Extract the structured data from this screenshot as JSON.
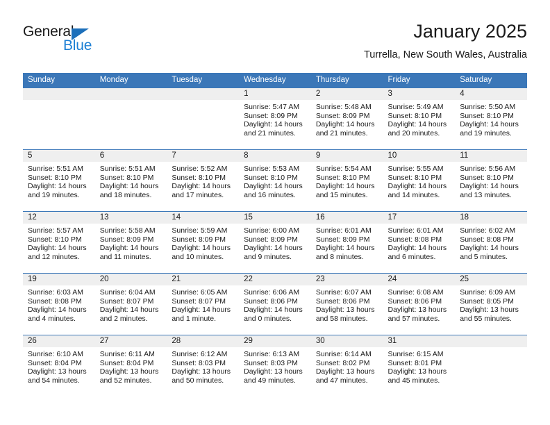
{
  "logo": {
    "word1": "General",
    "word2": "Blue",
    "triangle_color": "#1c6fba",
    "blue_color": "#1c7fd4"
  },
  "header": {
    "title": "January 2025",
    "subtitle": "Turrella, New South Wales, Australia"
  },
  "theme": {
    "header_bg": "#3b77b8",
    "datenum_bg": "#efefef",
    "text": "#1a1a1a"
  },
  "calendar": {
    "weekday_headers": [
      "Sunday",
      "Monday",
      "Tuesday",
      "Wednesday",
      "Thursday",
      "Friday",
      "Saturday"
    ],
    "weeks": [
      [
        {
          "day": "",
          "empty": true
        },
        {
          "day": "",
          "empty": true
        },
        {
          "day": "",
          "empty": true
        },
        {
          "day": "1",
          "sunrise": "Sunrise: 5:47 AM",
          "sunset": "Sunset: 8:09 PM",
          "daylight1": "Daylight: 14 hours",
          "daylight2": "and 21 minutes."
        },
        {
          "day": "2",
          "sunrise": "Sunrise: 5:48 AM",
          "sunset": "Sunset: 8:09 PM",
          "daylight1": "Daylight: 14 hours",
          "daylight2": "and 21 minutes."
        },
        {
          "day": "3",
          "sunrise": "Sunrise: 5:49 AM",
          "sunset": "Sunset: 8:10 PM",
          "daylight1": "Daylight: 14 hours",
          "daylight2": "and 20 minutes."
        },
        {
          "day": "4",
          "sunrise": "Sunrise: 5:50 AM",
          "sunset": "Sunset: 8:10 PM",
          "daylight1": "Daylight: 14 hours",
          "daylight2": "and 19 minutes."
        }
      ],
      [
        {
          "day": "5",
          "sunrise": "Sunrise: 5:51 AM",
          "sunset": "Sunset: 8:10 PM",
          "daylight1": "Daylight: 14 hours",
          "daylight2": "and 19 minutes."
        },
        {
          "day": "6",
          "sunrise": "Sunrise: 5:51 AM",
          "sunset": "Sunset: 8:10 PM",
          "daylight1": "Daylight: 14 hours",
          "daylight2": "and 18 minutes."
        },
        {
          "day": "7",
          "sunrise": "Sunrise: 5:52 AM",
          "sunset": "Sunset: 8:10 PM",
          "daylight1": "Daylight: 14 hours",
          "daylight2": "and 17 minutes."
        },
        {
          "day": "8",
          "sunrise": "Sunrise: 5:53 AM",
          "sunset": "Sunset: 8:10 PM",
          "daylight1": "Daylight: 14 hours",
          "daylight2": "and 16 minutes."
        },
        {
          "day": "9",
          "sunrise": "Sunrise: 5:54 AM",
          "sunset": "Sunset: 8:10 PM",
          "daylight1": "Daylight: 14 hours",
          "daylight2": "and 15 minutes."
        },
        {
          "day": "10",
          "sunrise": "Sunrise: 5:55 AM",
          "sunset": "Sunset: 8:10 PM",
          "daylight1": "Daylight: 14 hours",
          "daylight2": "and 14 minutes."
        },
        {
          "day": "11",
          "sunrise": "Sunrise: 5:56 AM",
          "sunset": "Sunset: 8:10 PM",
          "daylight1": "Daylight: 14 hours",
          "daylight2": "and 13 minutes."
        }
      ],
      [
        {
          "day": "12",
          "sunrise": "Sunrise: 5:57 AM",
          "sunset": "Sunset: 8:10 PM",
          "daylight1": "Daylight: 14 hours",
          "daylight2": "and 12 minutes."
        },
        {
          "day": "13",
          "sunrise": "Sunrise: 5:58 AM",
          "sunset": "Sunset: 8:09 PM",
          "daylight1": "Daylight: 14 hours",
          "daylight2": "and 11 minutes."
        },
        {
          "day": "14",
          "sunrise": "Sunrise: 5:59 AM",
          "sunset": "Sunset: 8:09 PM",
          "daylight1": "Daylight: 14 hours",
          "daylight2": "and 10 minutes."
        },
        {
          "day": "15",
          "sunrise": "Sunrise: 6:00 AM",
          "sunset": "Sunset: 8:09 PM",
          "daylight1": "Daylight: 14 hours",
          "daylight2": "and 9 minutes."
        },
        {
          "day": "16",
          "sunrise": "Sunrise: 6:01 AM",
          "sunset": "Sunset: 8:09 PM",
          "daylight1": "Daylight: 14 hours",
          "daylight2": "and 8 minutes."
        },
        {
          "day": "17",
          "sunrise": "Sunrise: 6:01 AM",
          "sunset": "Sunset: 8:08 PM",
          "daylight1": "Daylight: 14 hours",
          "daylight2": "and 6 minutes."
        },
        {
          "day": "18",
          "sunrise": "Sunrise: 6:02 AM",
          "sunset": "Sunset: 8:08 PM",
          "daylight1": "Daylight: 14 hours",
          "daylight2": "and 5 minutes."
        }
      ],
      [
        {
          "day": "19",
          "sunrise": "Sunrise: 6:03 AM",
          "sunset": "Sunset: 8:08 PM",
          "daylight1": "Daylight: 14 hours",
          "daylight2": "and 4 minutes."
        },
        {
          "day": "20",
          "sunrise": "Sunrise: 6:04 AM",
          "sunset": "Sunset: 8:07 PM",
          "daylight1": "Daylight: 14 hours",
          "daylight2": "and 2 minutes."
        },
        {
          "day": "21",
          "sunrise": "Sunrise: 6:05 AM",
          "sunset": "Sunset: 8:07 PM",
          "daylight1": "Daylight: 14 hours",
          "daylight2": "and 1 minute."
        },
        {
          "day": "22",
          "sunrise": "Sunrise: 6:06 AM",
          "sunset": "Sunset: 8:06 PM",
          "daylight1": "Daylight: 14 hours",
          "daylight2": "and 0 minutes."
        },
        {
          "day": "23",
          "sunrise": "Sunrise: 6:07 AM",
          "sunset": "Sunset: 8:06 PM",
          "daylight1": "Daylight: 13 hours",
          "daylight2": "and 58 minutes."
        },
        {
          "day": "24",
          "sunrise": "Sunrise: 6:08 AM",
          "sunset": "Sunset: 8:06 PM",
          "daylight1": "Daylight: 13 hours",
          "daylight2": "and 57 minutes."
        },
        {
          "day": "25",
          "sunrise": "Sunrise: 6:09 AM",
          "sunset": "Sunset: 8:05 PM",
          "daylight1": "Daylight: 13 hours",
          "daylight2": "and 55 minutes."
        }
      ],
      [
        {
          "day": "26",
          "sunrise": "Sunrise: 6:10 AM",
          "sunset": "Sunset: 8:04 PM",
          "daylight1": "Daylight: 13 hours",
          "daylight2": "and 54 minutes."
        },
        {
          "day": "27",
          "sunrise": "Sunrise: 6:11 AM",
          "sunset": "Sunset: 8:04 PM",
          "daylight1": "Daylight: 13 hours",
          "daylight2": "and 52 minutes."
        },
        {
          "day": "28",
          "sunrise": "Sunrise: 6:12 AM",
          "sunset": "Sunset: 8:03 PM",
          "daylight1": "Daylight: 13 hours",
          "daylight2": "and 50 minutes."
        },
        {
          "day": "29",
          "sunrise": "Sunrise: 6:13 AM",
          "sunset": "Sunset: 8:03 PM",
          "daylight1": "Daylight: 13 hours",
          "daylight2": "and 49 minutes."
        },
        {
          "day": "30",
          "sunrise": "Sunrise: 6:14 AM",
          "sunset": "Sunset: 8:02 PM",
          "daylight1": "Daylight: 13 hours",
          "daylight2": "and 47 minutes."
        },
        {
          "day": "31",
          "sunrise": "Sunrise: 6:15 AM",
          "sunset": "Sunset: 8:01 PM",
          "daylight1": "Daylight: 13 hours",
          "daylight2": "and 45 minutes."
        },
        {
          "day": "",
          "empty": true
        }
      ]
    ]
  }
}
